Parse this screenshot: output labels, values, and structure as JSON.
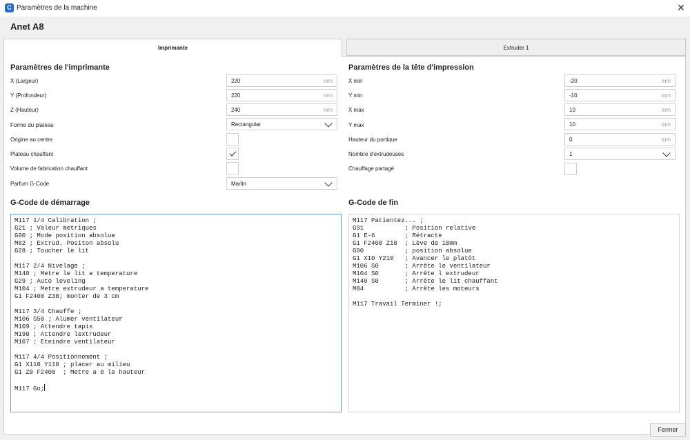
{
  "window": {
    "title": "Paramètres de la machine",
    "close_glyph": "✕",
    "app_icon": "C"
  },
  "machine": {
    "name": "Anet A8"
  },
  "tabs": [
    {
      "label": "Imprimante",
      "active": true
    },
    {
      "label": "Extruder 1",
      "active": false
    }
  ],
  "printer_settings": {
    "title": "Paramètres de l'imprimante",
    "x": {
      "label": "X (Largeur)",
      "value": "220",
      "unit": "mm"
    },
    "y": {
      "label": "Y (Profondeur)",
      "value": "220",
      "unit": "mm"
    },
    "z": {
      "label": "Z (Hauteur)",
      "value": "240",
      "unit": "mm"
    },
    "bed_shape": {
      "label": "Forme du plateau",
      "value": "Rectangular"
    },
    "origin_center": {
      "label": "Origine au centre",
      "checked": false
    },
    "heated_bed": {
      "label": "Plateau chauffant",
      "checked": true
    },
    "heated_volume": {
      "label": "Volume de fabrication chauffant",
      "checked": false
    },
    "gcode_flavor": {
      "label": "Parfum G-Code",
      "value": "Marlin"
    }
  },
  "head_settings": {
    "title": "Paramètres de la tête d'impression",
    "x_min": {
      "label": "X min",
      "value": "-20",
      "unit": "mm"
    },
    "y_min": {
      "label": "Y min",
      "value": "-10",
      "unit": "mm"
    },
    "x_max": {
      "label": "X max",
      "value": "10",
      "unit": "mm"
    },
    "y_max": {
      "label": "Y max",
      "value": "10",
      "unit": "mm"
    },
    "gantry_height": {
      "label": "Hauteur du portique",
      "value": "0",
      "unit": "mm"
    },
    "extruder_count": {
      "label": "Nombre d'extrudeuses",
      "value": "1"
    },
    "shared_heater": {
      "label": "Chauffage partagé",
      "checked": false
    }
  },
  "start_gcode": {
    "title": "G-Code de démarrage",
    "text": "M117 1/4 Calibration ;\nG21 ; Valeur metriques\nG90 ; Mode position absolue\nM82 ; Extrud. Positon absolu\nG28 ; Toucher le lit\n\nM117 2/4 Nivelage ;\nM140 ; Metre le lit a temperature\nG29 ; Auto leveling\nM104 ; Metre extrudeur a temperature\nG1 F2400 Z30; monter de 3 cm\n\nM117 3/4 Chauffe ;\nM106 S50 ; Alumer ventilateur\nM109 ; Attendre tapis\nM190 ; Attendre lextrudeur\nM107 ; Eteindre ventilateur\n\nM117 4/4 Positionnement ;\nG1 X110 Y110 ; placer au milieu\nG1 Z0 F2400  ; Metre a 0 la hauteur\n\nM117 Go;"
  },
  "end_gcode": {
    "title": "G-Code de fin",
    "text": "M117 Patientez... ;\nG91           ; Position relative\nG1 E-6        ; Rétracte\nG1 F2400 Z10  ; Lève de 10mm\nG90           ; position absolue\nG1 X10 Y210   ; Avancer le platôt\nM106 S0       ; Arrête le ventilateur\nM104 S0       ; Arrête l extrudeur\nM140 S0       ; Arrête le lit chauffant\nM84           ; Arrête les moteurs\n\nM117 Travail Terminer !;"
  },
  "footer": {
    "close_label": "Fermer"
  }
}
